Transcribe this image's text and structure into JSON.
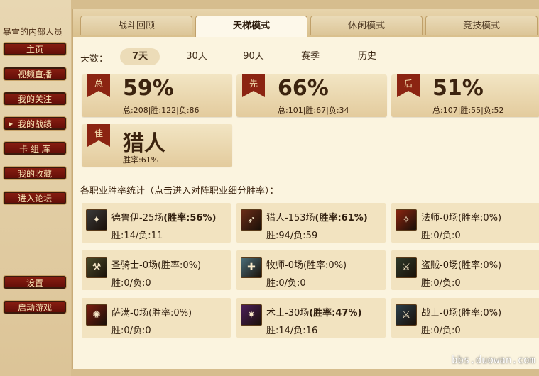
{
  "sidebar": {
    "user": "暴雪的内部人员",
    "items": [
      {
        "label": "主页"
      },
      {
        "label": "视频直播"
      },
      {
        "label": "我的关注"
      },
      {
        "label": "我的战绩",
        "bullet": "▶"
      },
      {
        "label": "卡 组 库"
      },
      {
        "label": "我的收藏"
      },
      {
        "label": "进入论坛"
      }
    ],
    "bottom_items": [
      {
        "label": "设置"
      },
      {
        "label": "启动游戏"
      }
    ]
  },
  "tabs": [
    {
      "label": "战斗回顾"
    },
    {
      "label": "天梯模式"
    },
    {
      "label": "休闲模式"
    },
    {
      "label": "竞技模式"
    }
  ],
  "days": {
    "label": "天数：",
    "options": [
      "7天",
      "30天",
      "90天",
      "赛季",
      "历史"
    ],
    "selected": "7天"
  },
  "stats": [
    {
      "badge": "总",
      "value": "59%",
      "detail": "总:208|胜:122|负:86"
    },
    {
      "badge": "先",
      "value": "66%",
      "detail": "总:101|胜:67|负:34"
    },
    {
      "badge": "后",
      "value": "51%",
      "detail": "总:107|胜:55|负:52"
    },
    {
      "badge": "佳",
      "value": "猎人",
      "detail": "胜率:61%"
    }
  ],
  "section_title": "各职业胜率统计（点击进入对阵职业细分胜率）：",
  "classes": [
    {
      "name_games": "德鲁伊-25场",
      "rate": "(胜率:56%)",
      "rate_bold": true,
      "record": "胜:14/负:11",
      "icon": "druid-icon",
      "color": "#3a3a3a"
    },
    {
      "name_games": "猎人-153场",
      "rate": "(胜率:61%)",
      "rate_bold": true,
      "record": "胜:94/负:59",
      "icon": "hunter-icon",
      "color": "#6a2c18"
    },
    {
      "name_games": "法师-0场",
      "rate": "(胜率:0%)",
      "rate_bold": false,
      "record": "胜:0/负:0",
      "icon": "mage-icon",
      "color": "#8a2410"
    },
    {
      "name_games": "圣骑士-0场",
      "rate": "(胜率:0%)",
      "rate_bold": false,
      "record": "胜:0/负:0",
      "icon": "paladin-icon",
      "color": "#4a4a2a"
    },
    {
      "name_games": "牧师-0场",
      "rate": "(胜率:0%)",
      "rate_bold": false,
      "record": "胜:0/负:0",
      "icon": "priest-icon",
      "color": "#4a6e7a"
    },
    {
      "name_games": "盗贼-0场",
      "rate": "(胜率:0%)",
      "rate_bold": false,
      "record": "胜:0/负:0",
      "icon": "rogue-icon",
      "color": "#2e3a2a"
    },
    {
      "name_games": "萨满-0场",
      "rate": "(胜率:0%)",
      "rate_bold": false,
      "record": "胜:0/负:0",
      "icon": "shaman-icon",
      "color": "#7a1e10"
    },
    {
      "name_games": "术士-30场",
      "rate": "(胜率:47%)",
      "rate_bold": true,
      "record": "胜:14/负:16",
      "icon": "warlock-icon",
      "color": "#4a1e5a"
    },
    {
      "name_games": "战士-0场",
      "rate": "(胜率:0%)",
      "rate_bold": false,
      "record": "胜:0/负:0",
      "icon": "warrior-icon",
      "color": "#2a3e4a"
    }
  ],
  "watermark": "bbs.duowan.com"
}
